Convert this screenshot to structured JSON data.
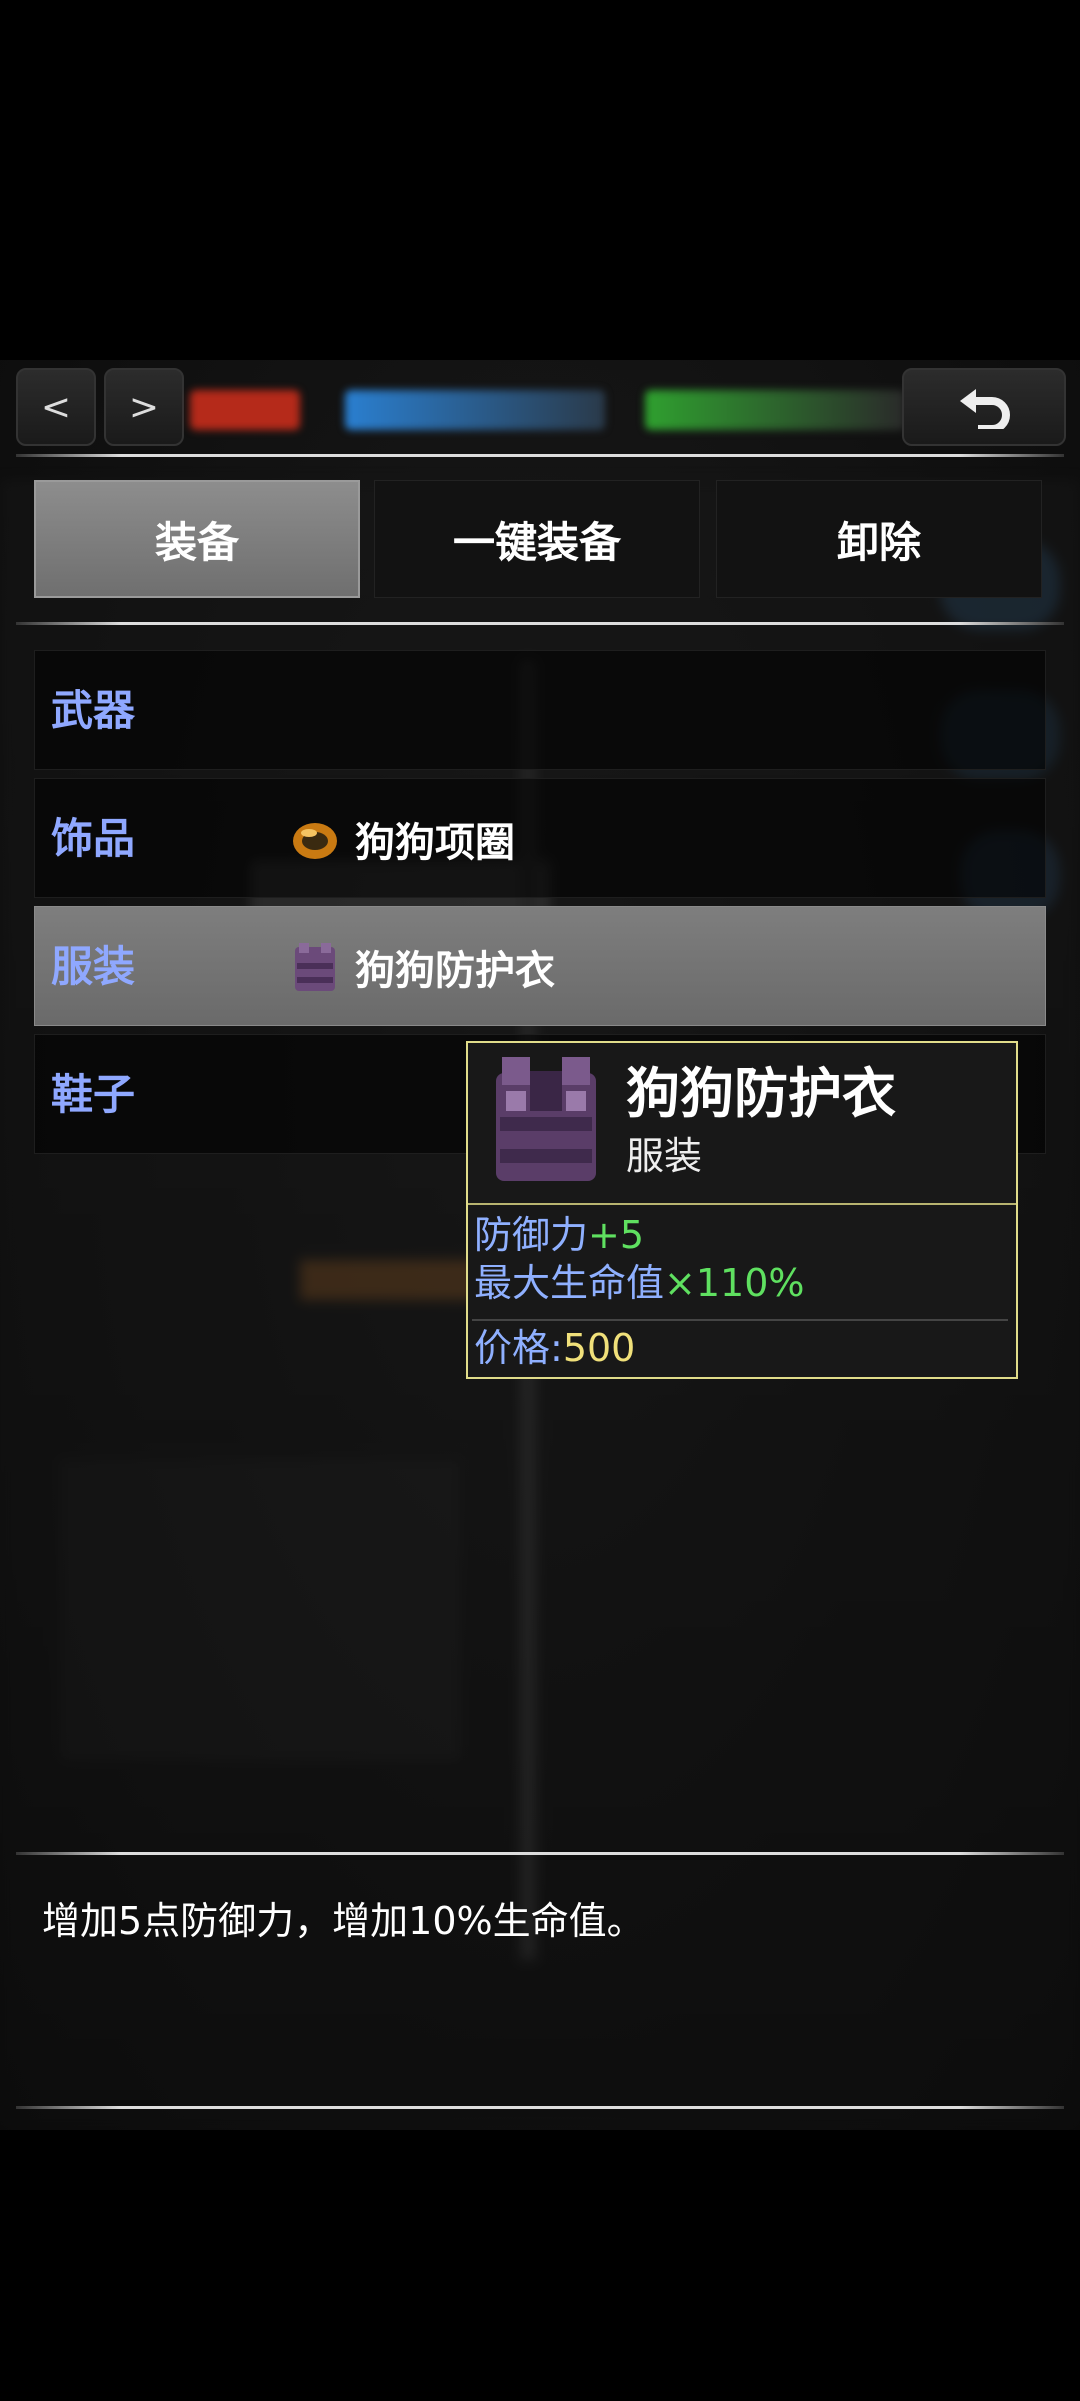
{
  "top_bar": {
    "prev": "<",
    "next": ">"
  },
  "tabs": [
    {
      "label": "装备",
      "active": true
    },
    {
      "label": "一键装备",
      "active": false
    },
    {
      "label": "卸除",
      "active": false
    }
  ],
  "slots": [
    {
      "label": "武器",
      "item": ""
    },
    {
      "label": "饰品",
      "item": "狗狗项圈",
      "icon": "ring-icon"
    },
    {
      "label": "服装",
      "item": "狗狗防护衣",
      "icon": "armor-vest-icon",
      "selected": true
    },
    {
      "label": "鞋子",
      "item": ""
    }
  ],
  "tooltip": {
    "name": "狗狗防护衣",
    "type": "服装",
    "stat1_label": "防御力",
    "stat1_value": "+5",
    "stat2_label": "最大生命值",
    "stat2_value": "×110%",
    "price_label": "价格:",
    "price_value": "500"
  },
  "description": "增加5点防御力，增加10%生命值。",
  "colors": {
    "slot_label": "#8fa8ff",
    "bonus": "#5fe060",
    "price": "#f0e07a",
    "tooltip_border": "#e0dc8a"
  }
}
